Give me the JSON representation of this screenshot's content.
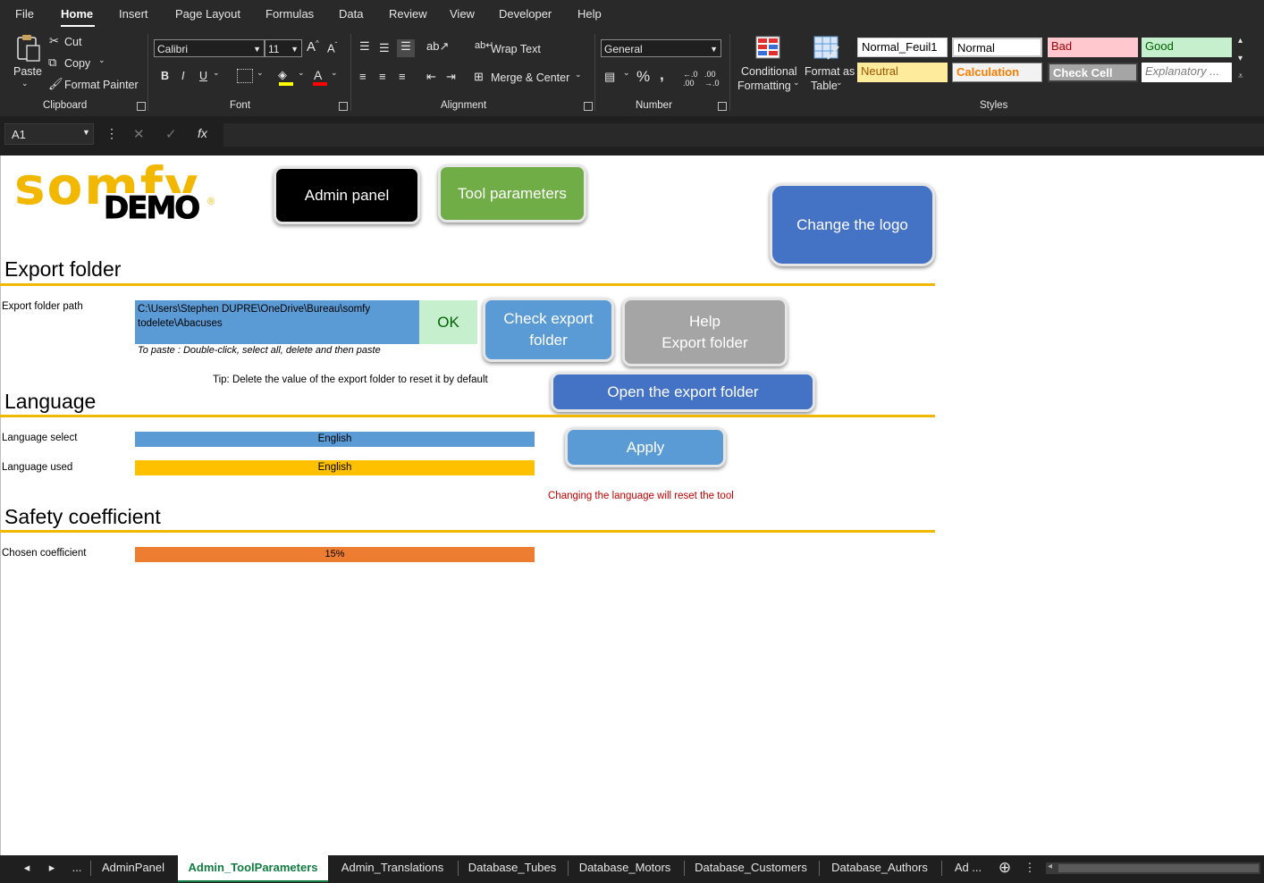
{
  "menu": [
    "File",
    "Home",
    "Insert",
    "Page Layout",
    "Formulas",
    "Data",
    "Review",
    "View",
    "Developer",
    "Help"
  ],
  "ribbon": {
    "clipboard": {
      "paste": "Paste",
      "cut": "Cut",
      "copy": "Copy",
      "format_painter": "Format Painter",
      "label": "Clipboard"
    },
    "font": {
      "name": "Calibri",
      "size": "11",
      "bold": "B",
      "italic": "I",
      "underline": "U",
      "label": "Font"
    },
    "alignment": {
      "wrap_text": "Wrap Text",
      "merge_center": "Merge & Center",
      "label": "Alignment"
    },
    "number": {
      "format": "General",
      "label": "Number"
    },
    "styles": {
      "conditional_formatting_1": "Conditional",
      "conditional_formatting_2": "Formatting",
      "format_as_table_1": "Format as",
      "format_as_table_2": "Table",
      "cells": [
        "Normal_Feuil1",
        "Normal",
        "Bad",
        "Good",
        "Neutral",
        "Calculation",
        "Check Cell",
        "Explanatory ..."
      ],
      "label": "Styles"
    }
  },
  "formula_bar": {
    "name_box": "A1",
    "value": ""
  },
  "sheet": {
    "logo_text": "somfy",
    "logo_demo": "DEMO",
    "logo_reg": "®",
    "buttons": {
      "admin_panel": "Admin panel",
      "tool_parameters": "Tool parameters",
      "change_logo": "Change the logo",
      "check_export_folder": "Check export folder",
      "help_export_folder_1": "Help",
      "help_export_folder_2": "Export folder",
      "open_export_folder": "Open the export folder",
      "apply": "Apply"
    },
    "export": {
      "heading": "Export folder",
      "path_label": "Export folder path",
      "path_value": "C:\\Users\\Stephen DUPRE\\OneDrive\\Bureau\\somfy todelete\\Abacuses",
      "ok": "OK",
      "paste_hint": "To paste : Double-click, select all, delete and then paste",
      "tip": "Tip: Delete the value of the export folder to reset it by default"
    },
    "language": {
      "heading": "Language",
      "select_label": "Language select",
      "select_value": "English",
      "used_label": "Language used",
      "used_value": "English",
      "warning": "Changing the language will reset the tool"
    },
    "safety": {
      "heading": "Safety coefficient",
      "label": "Chosen coefficient",
      "value": "15%"
    }
  },
  "tabs": {
    "nav_prev": "◂",
    "nav_next": "▸",
    "more": "...",
    "items": [
      "AdminPanel",
      "Admin_ToolParameters",
      "Admin_Translations",
      "Database_Tubes",
      "Database_Motors",
      "Database_Customers",
      "Database_Authors",
      "Ad ..."
    ],
    "active": "Admin_ToolParameters"
  },
  "colors": {
    "accent_rule": "#f2b800",
    "active_tab": "#107c41",
    "blue_cell": "#5b9bd5",
    "yellow_cell": "#ffc000",
    "orange_cell": "#ed7d31",
    "ok_green": "#c6efce"
  }
}
